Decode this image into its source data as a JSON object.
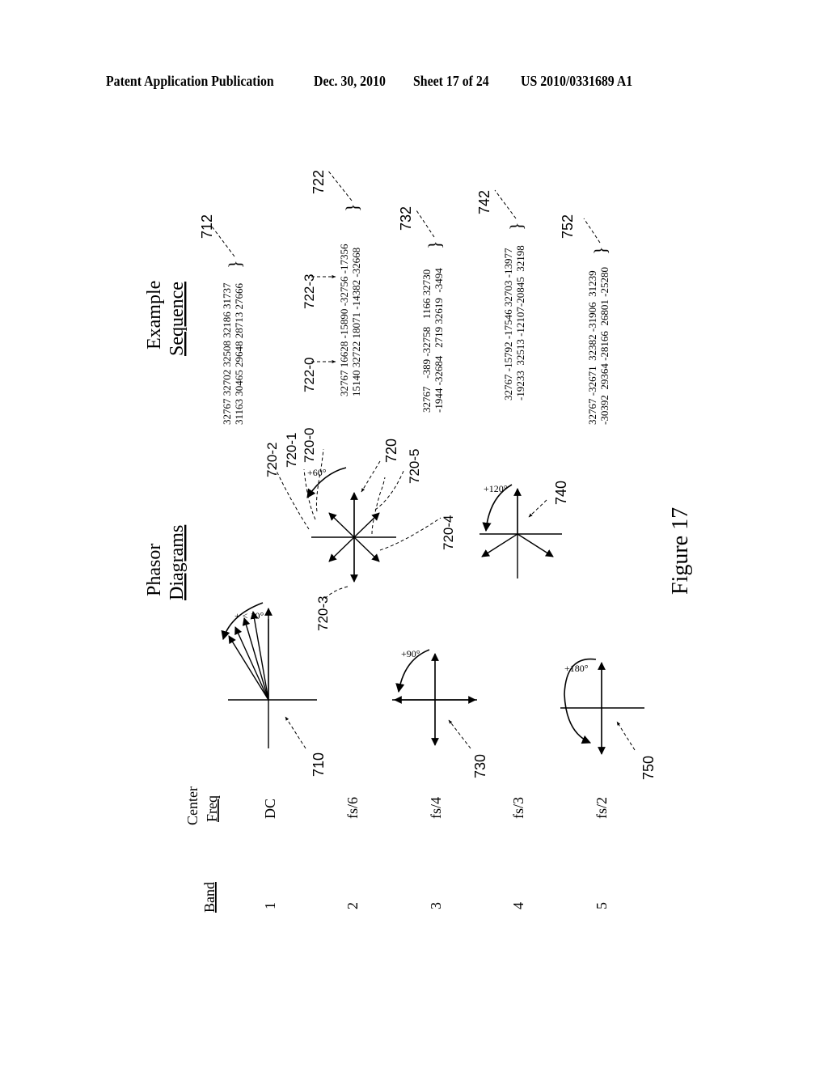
{
  "header": {
    "publication": "Patent Application Publication",
    "date": "Dec. 30, 2010",
    "sheet": "Sheet 17 of 24",
    "number": "US 2010/0331689 A1"
  },
  "columns": {
    "band": "Band",
    "center_line1": "Center",
    "center_line2": "Freq",
    "phasor_line1": "Phasor",
    "phasor_line2": "Diagrams",
    "example_line1": "Example",
    "example_line2": "Sequence"
  },
  "rows": [
    {
      "band": "1",
      "freq": "DC",
      "diagram_ref": "710",
      "angle": "+ < 10°",
      "seq_ref": "712",
      "seq_line1": "32767 32702 32508 32186 31737",
      "seq_line2": "31163 30465 29648 28713 27666"
    },
    {
      "band": "2",
      "freq": "fs/6",
      "diagram_ref": "720",
      "angle": "+60°",
      "seq_ref": "722",
      "seq_line1": "32767 16628 -15890 -32756 -17356",
      "seq_line2": "15140 32722 18071 -14382 -32668",
      "seq_sub_refs": [
        "722-0",
        "722-3"
      ],
      "vector_refs": [
        "720-0",
        "720-1",
        "720-2",
        "720-3",
        "720-4",
        "720-5"
      ]
    },
    {
      "band": "3",
      "freq": "fs/4",
      "diagram_ref": "730",
      "angle": "+90°",
      "seq_ref": "732",
      "seq_line1": "32767   -389 -32758   1166 32730",
      "seq_line2": "-1944 -32684   2719 32619  -3494"
    },
    {
      "band": "4",
      "freq": "fs/3",
      "diagram_ref": "740",
      "angle": "+120°",
      "seq_ref": "742",
      "seq_line1": "32767 -15792 -17546 32703 -13977",
      "seq_line2": "-19233  32513 -12107-20845  32198"
    },
    {
      "band": "5",
      "freq": "fs/2",
      "diagram_ref": "750",
      "angle": "+180°",
      "seq_ref": "752",
      "seq_line1": "32767 -32671  32382 -31906  31239",
      "seq_line2": "-30392  29364 -28166  26801 -25280"
    }
  ],
  "figure_caption": "Figure 17"
}
